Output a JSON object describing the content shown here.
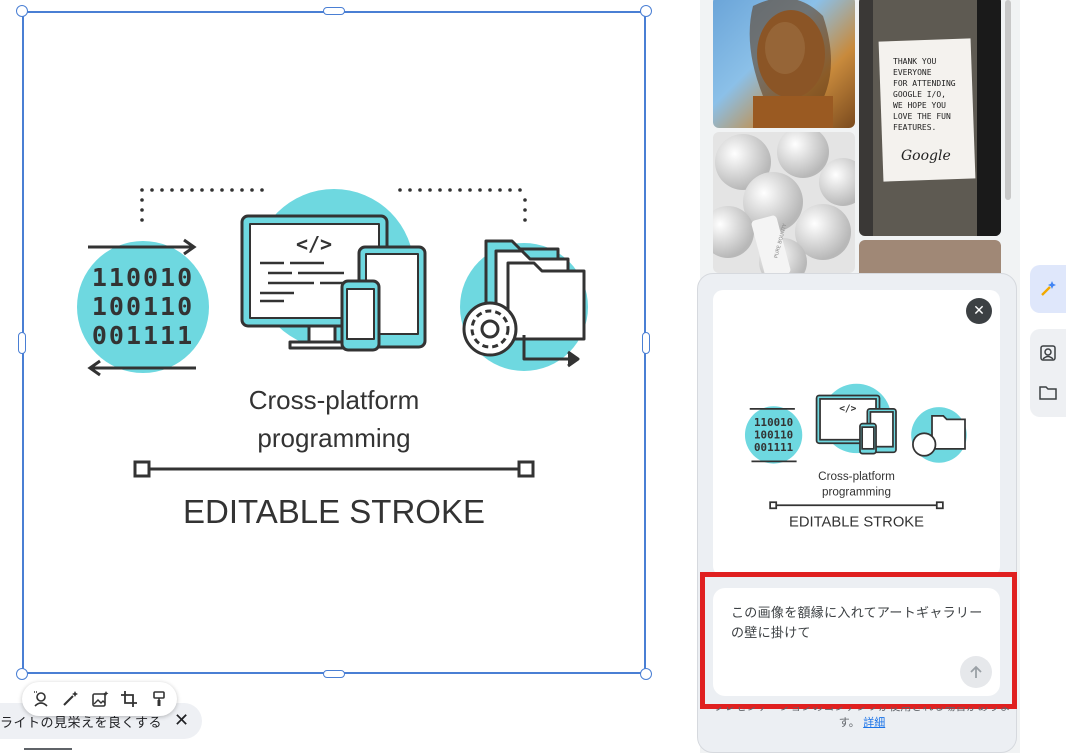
{
  "canvas": {
    "artwork": {
      "binary_rows": [
        "110010",
        "100110",
        "001111"
      ],
      "code_tag": "</>",
      "caption_line1": "Cross-platform",
      "caption_line2": "programming",
      "stroke_label": "EDITABLE STROKE"
    },
    "toolbar": {
      "icons": [
        "remove-background-icon",
        "magic-edit-icon",
        "image-generate-icon",
        "crop-icon",
        "paint-format-icon"
      ]
    },
    "enhance_chip": {
      "label": "ライトの見栄えを良くする",
      "close": "✕"
    }
  },
  "gallery": {
    "photos": [
      {
        "name": "portrait-photo"
      },
      {
        "name": "thank-you-note-photo",
        "note_lines": [
          "THANK YOU",
          "EVERYONE",
          "FOR ATTENDING",
          "GOOGLE I/O,",
          "WE HOPE YOU",
          "LOVE THE FUN",
          "FEATURES."
        ],
        "signature": "Google"
      },
      {
        "name": "white-spheres-photo",
        "product_label": "PURE BOUNTY"
      },
      {
        "name": "brown-photo"
      }
    ]
  },
  "ai_panel": {
    "close_icon": "✕",
    "preview": {
      "binary_rows": [
        "110010",
        "100110",
        "001111"
      ],
      "code_tag": "</>",
      "caption_line1": "Cross-platform",
      "caption_line2": "programming",
      "stroke_label": "EDITABLE STROKE"
    },
    "prompt": {
      "text": "この画像を額縁に入れてアートギャラリーの壁に掛けて",
      "send_icon": "arrow-up-icon"
    },
    "disclaimer": {
      "text_top": "プレゼンテーションのコンテンツが使用される場合があります。",
      "text_end": "す。",
      "link": "詳細"
    }
  },
  "rail": {
    "items": [
      "sparkle-icon",
      "image-search-icon",
      "folder-icon"
    ]
  },
  "colors": {
    "selection": "#4a7fd4",
    "teal": "#6ed8e0",
    "highlight": "#e02020",
    "link": "#1a73e8"
  }
}
